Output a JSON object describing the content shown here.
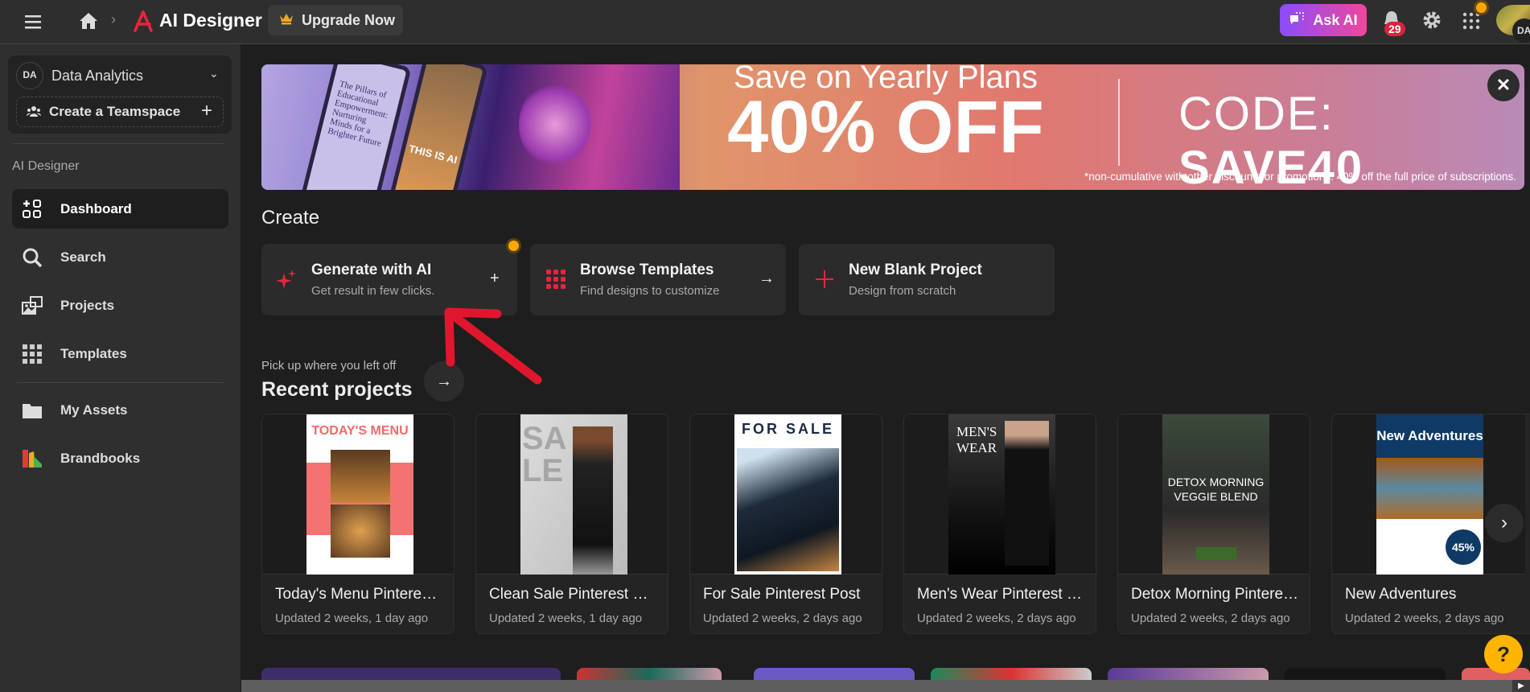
{
  "topbar": {
    "app_title": "AI Designer",
    "upgrade_label": "Upgrade Now",
    "ask_ai_label": "Ask AI",
    "notification_count": "29",
    "avatar_initials": "DA"
  },
  "sidebar": {
    "workspace_initials": "DA",
    "workspace_name": "Data Analytics",
    "create_teamspace_label": "Create a Teamspace",
    "section_label": "AI Designer",
    "items": [
      {
        "label": "Dashboard",
        "icon": "dashboard-icon"
      },
      {
        "label": "Search",
        "icon": "search-icon"
      },
      {
        "label": "Projects",
        "icon": "projects-icon"
      },
      {
        "label": "Templates",
        "icon": "grid-icon"
      },
      {
        "label": "My Assets",
        "icon": "folder-icon"
      },
      {
        "label": "Brandbooks",
        "icon": "brandbook-icon"
      }
    ]
  },
  "banner": {
    "headline": "Save on Yearly Plans",
    "offer": "40% OFF",
    "code_label": "CODE:",
    "code": "SAVE40",
    "footnote": "*non-cumulative with other discounts or promotions. 40% off the full price of subscriptions.",
    "artboard_title": "The Pillars of Educational Empowerment: Nurturing Minds for a Brighter Future",
    "artboard_caption": "THIS IS AI"
  },
  "create": {
    "heading": "Create",
    "cards": [
      {
        "title": "Generate with AI",
        "subtitle": "Get result in few clicks."
      },
      {
        "title": "Browse Templates",
        "subtitle": "Find designs to customize"
      },
      {
        "title": "New Blank Project",
        "subtitle": "Design from scratch"
      }
    ]
  },
  "recent": {
    "kicker": "Pick up where you left off",
    "heading": "Recent projects",
    "projects": [
      {
        "title": "Today's Menu Pinterest Post",
        "updated": "Updated 2 weeks, 1 day ago",
        "thumb": "TODAY'S MENU"
      },
      {
        "title": "Clean Sale Pinterest Post",
        "updated": "Updated 2 weeks, 1 day ago",
        "thumb": "SALE"
      },
      {
        "title": "For Sale Pinterest Post",
        "updated": "Updated 2 weeks, 2 days ago",
        "thumb": "FOR SALE"
      },
      {
        "title": "Men's Wear Pinterest Post",
        "updated": "Updated 2 weeks, 2 days ago",
        "thumb": "MEN'S WEAR"
      },
      {
        "title": "Detox Morning Pinterest Post",
        "updated": "Updated 2 weeks, 2 days ago",
        "thumb": "DETOX MORNING VEGGIE BLEND"
      },
      {
        "title": "New Adventures",
        "updated": "Updated 2 weeks, 2 days ago",
        "thumb": "New Adventures",
        "thumb_badge": "45%"
      }
    ]
  },
  "help_label": "?",
  "colors": {
    "accent": "#e8253f",
    "ask_ai_start": "#8a4dfb",
    "ask_ai_end": "#f0479a",
    "help": "#ffb400",
    "notification_dot": "#ffa500"
  }
}
